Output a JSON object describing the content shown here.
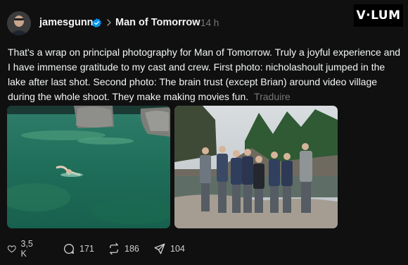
{
  "post": {
    "username": "jamesgunn",
    "community": "Man of Tomorrow",
    "timestamp": "14 h",
    "text": "That's a wrap on principal photography for Man of Tomorrow. Truly a joyful experience and I have immense gratitude to my cast and crew. First photo: nicholashoult jumped in the lake after last shot. Second photo: The brain trust (except Brian) around video village during the whole shoot. They make making movies fun.",
    "translate_label": "Traduire"
  },
  "watermark": {
    "text": "V·LUM"
  },
  "actions": {
    "likes": "3,5 K",
    "replies": "171",
    "reposts": "186",
    "shares": "104"
  },
  "colors": {
    "background": "#101010",
    "text": "#f3f5f7",
    "muted": "#777777",
    "verified": "#0095f6"
  },
  "icons": [
    "verified-badge-icon",
    "chevron-right-icon",
    "heart-icon",
    "comment-icon",
    "repost-icon",
    "share-icon"
  ]
}
